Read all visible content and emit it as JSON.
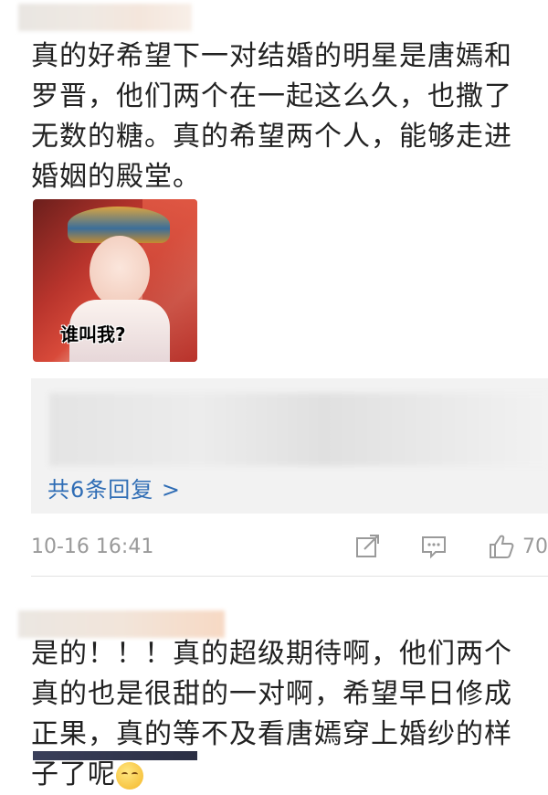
{
  "comment1": {
    "text": "真的好希望下一对结婚的明星是唐嫣和罗晋，他们两个在一起这么久，也撒了无数的糖。真的希望两个人，能够走进婚姻的殿堂。",
    "sticker_caption": "谁叫我?"
  },
  "replies": {
    "count_label": "共6条回复 >"
  },
  "meta": {
    "timestamp": "10-16 16:41",
    "like_count": "70"
  },
  "comment2": {
    "text": "是的！！！真的超级期待啊，他们两个真的也是很甜的一对啊，希望早日修成正果，真的等不及看唐嫣穿上婚纱的样子了呢"
  },
  "colors": {
    "link": "#2f6db5",
    "meta": "#9a9a9a",
    "reply_bg": "#f2f2f2"
  }
}
